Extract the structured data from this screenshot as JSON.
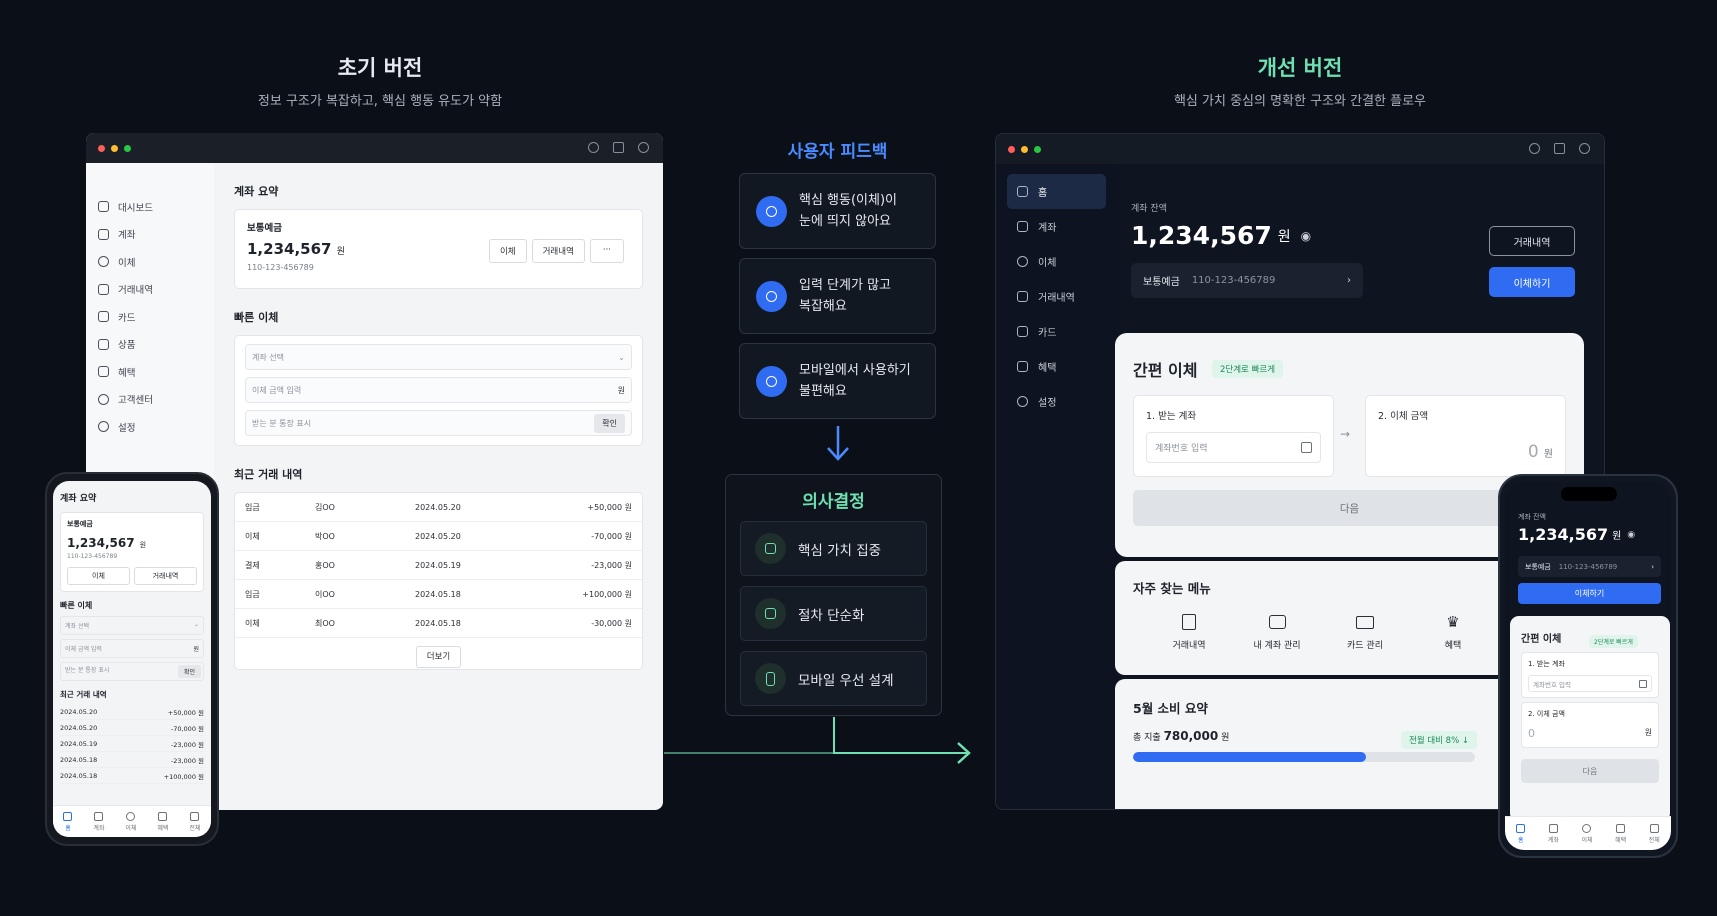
{
  "before": {
    "title": "초기 버전",
    "subtitle": "정보 구조가 복잡하고, 핵심 행동 유도가 약함",
    "sidebar": [
      "대시보드",
      "계좌",
      "이체",
      "거래내역",
      "카드",
      "상품",
      "혜택",
      "고객센터",
      "설정"
    ],
    "account_summary": {
      "heading": "계좌 요약",
      "account_name": "보통예금",
      "balance": "1,234,567",
      "currency": "원",
      "account_number": "110-123-456789",
      "buttons": [
        "이체",
        "거래내역",
        "···"
      ]
    },
    "quick_transfer": {
      "heading": "빠른 이체",
      "account_select": "계좌 선택",
      "amount_placeholder": "이체 금액 입력",
      "amount_unit": "원",
      "memo_placeholder": "받는 분 통장 표시",
      "confirm": "확인"
    },
    "recent": {
      "heading": "최근 거래 내역",
      "rows": [
        {
          "type": "입금",
          "name": "김OO",
          "date": "2024.05.20",
          "amount": "+50,000 원"
        },
        {
          "type": "이체",
          "name": "박OO",
          "date": "2024.05.20",
          "amount": "-70,000 원"
        },
        {
          "type": "결제",
          "name": "홍OO",
          "date": "2024.05.19",
          "amount": "-23,000 원"
        },
        {
          "type": "입금",
          "name": "이OO",
          "date": "2024.05.18",
          "amount": "+100,000 원"
        },
        {
          "type": "이체",
          "name": "최OO",
          "date": "2024.05.18",
          "amount": "-30,000 원"
        }
      ],
      "more": "더보기"
    },
    "mobile": {
      "heading": "계좌 요약",
      "account_name": "보통예금",
      "balance": "1,234,567",
      "currency": "원",
      "account_number": "110-123-456789",
      "buttons": [
        "이체",
        "거래내역"
      ],
      "quick_heading": "빠른 이체",
      "account_select": "계좌 선택",
      "amount_placeholder": "이체 금액 입력",
      "amount_unit": "원",
      "memo_placeholder": "받는 분 통장 표시",
      "confirm": "확인",
      "recent_heading": "최근 거래 내역",
      "rows": [
        {
          "date": "2024.05.20",
          "amount": "+50,000 원"
        },
        {
          "date": "2024.05.20",
          "amount": "-70,000 원"
        },
        {
          "date": "2024.05.19",
          "amount": "-23,000 원"
        },
        {
          "date": "2024.05.18",
          "amount": "-23,000 원"
        },
        {
          "date": "2024.05.18",
          "amount": "+100,000 원"
        }
      ],
      "tabs": [
        "홈",
        "계좌",
        "이체",
        "혜택",
        "전체"
      ]
    }
  },
  "feedback": {
    "title": "사용자 피드백",
    "items": [
      {
        "line1": "핵심 행동(이체)이",
        "line2": "눈에 띄지 않아요"
      },
      {
        "line1": "입력 단계가 많고",
        "line2": "복잡해요"
      },
      {
        "line1": "모바일에서 사용하기",
        "line2": "불편해요"
      }
    ]
  },
  "decision": {
    "title": "의사결정",
    "items": [
      "핵심 가치 집중",
      "절차 단순화",
      "모바일 우선 설계"
    ]
  },
  "after": {
    "title": "개선 버전",
    "subtitle": "핵심 가치 중심의 명확한 구조와 간결한 플로우",
    "sidebar": [
      "홈",
      "계좌",
      "이체",
      "거래내역",
      "카드",
      "혜택",
      "설정"
    ],
    "balance_label": "계좌 잔액",
    "balance": "1,234,567",
    "currency": "원",
    "account_name": "보통예금",
    "account_number": "110-123-456789",
    "history_button": "거래내역",
    "transfer_button": "이체하기",
    "easy_transfer": {
      "heading": "간편 이체",
      "badge": "2단계로 빠르게",
      "step1": "1. 받는 계좌",
      "step1_placeholder": "계좌번호 입력",
      "step2": "2. 이체 금액",
      "amount": "0",
      "amount_unit": "원",
      "next": "다음"
    },
    "frequent_menu": {
      "heading": "자주 찾는 메뉴",
      "items": [
        "거래내역",
        "내 계좌 관리",
        "카드 관리",
        "혜택"
      ]
    },
    "spending": {
      "heading": "5월 소비 요약",
      "label": "총 지출",
      "amount": "780,000",
      "unit": "원",
      "badge": "전월 대비 8% ↓",
      "progress": 0.68
    },
    "mobile": {
      "balance_label": "계좌 잔액",
      "balance": "1,234,567",
      "currency": "원",
      "account_name": "보통예금",
      "account_number": "110-123-456789",
      "transfer_button": "이체하기",
      "heading": "간편 이체",
      "badge": "2단계로 빠르게",
      "step1": "1. 받는 계좌",
      "step1_placeholder": "계좌번호 입력",
      "step2": "2. 이체 금액",
      "amount": "0",
      "amount_unit": "원",
      "next": "다음",
      "tabs": [
        "홈",
        "계좌",
        "이체",
        "혜택",
        "전체"
      ]
    }
  },
  "colors": {
    "accent_blue": "#2f6cf2",
    "accent_green": "#6fe0b2",
    "feedback_title": "#4a8bff"
  }
}
